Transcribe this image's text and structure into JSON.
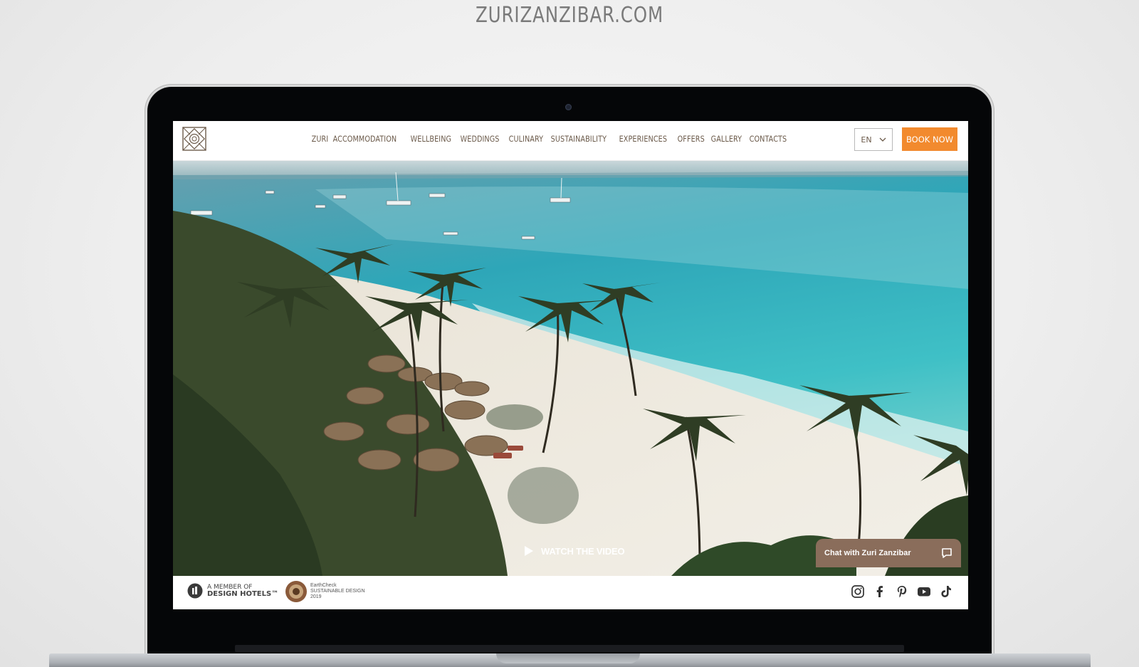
{
  "caption": "ZURIZANZIBAR.COM",
  "header": {
    "nav": [
      "ZURI",
      "ACCOMMODATION",
      "WELLBEING",
      "WEDDINGS",
      "CULINARY",
      "SUSTAINABILITY",
      "EXPERIENCES",
      "OFFERS",
      "GALLERY",
      "CONTACTS"
    ],
    "language": "EN",
    "book_label": "BOOK NOW"
  },
  "hero": {
    "watch_label": "WATCH THE VIDEO"
  },
  "chat": {
    "label": "Chat with Zuri Zanzibar"
  },
  "footer": {
    "design_hotels_line1": "A MEMBER OF",
    "design_hotels_line2": "DESIGN HOTELS™",
    "earthcheck_line1": "EarthCheck",
    "earthcheck_line2": "SUSTAINABLE DESIGN",
    "earthcheck_line3": "2019",
    "socials": [
      "instagram-icon",
      "facebook-icon",
      "pinterest-icon",
      "youtube-icon",
      "tiktok-icon"
    ]
  },
  "colors": {
    "accent": "#f28a2e",
    "brand_brown": "#8a6d5b",
    "nav_text": "#6b5a4a"
  }
}
